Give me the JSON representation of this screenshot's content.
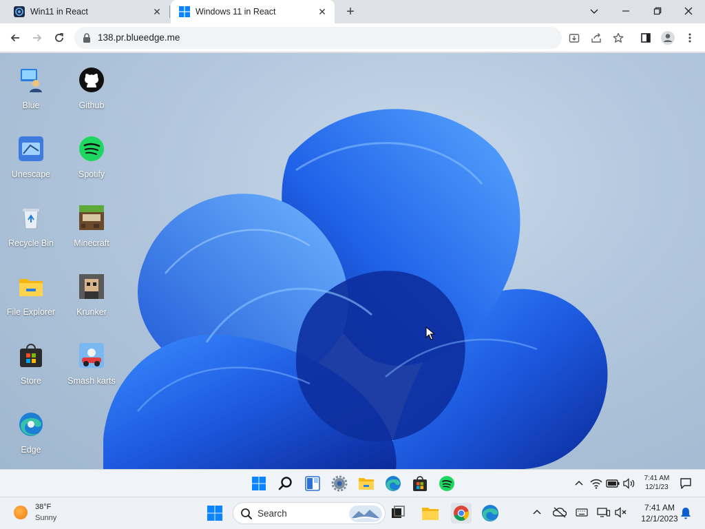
{
  "browser": {
    "tabs": [
      {
        "title": "Win11 in React",
        "active": false
      },
      {
        "title": "Windows 11 in React",
        "active": true
      }
    ],
    "address": "138.pr.blueedge.me"
  },
  "desktop": {
    "icons": [
      {
        "label": "Blue",
        "icon": "blue-user-icon"
      },
      {
        "label": "Github",
        "icon": "github-icon"
      },
      {
        "label": "Unescape",
        "icon": "unescape-icon"
      },
      {
        "label": "Spotify",
        "icon": "spotify-icon"
      },
      {
        "label": "Recycle Bin",
        "icon": "recycle-bin-icon"
      },
      {
        "label": "Minecraft",
        "icon": "minecraft-icon"
      },
      {
        "label": "File Explorer",
        "icon": "folder-icon"
      },
      {
        "label": "Krunker",
        "icon": "krunker-icon"
      },
      {
        "label": "Store",
        "icon": "store-icon"
      },
      {
        "label": "Smash karts",
        "icon": "smash-karts-icon"
      },
      {
        "label": "Edge",
        "icon": "edge-icon"
      }
    ]
  },
  "inner_taskbar": {
    "time": "7:41 AM",
    "date": "12/1/23"
  },
  "host_taskbar": {
    "weather_temp": "38°F",
    "weather_condition": "Sunny",
    "search_placeholder": "Search",
    "time": "7:41 AM",
    "date": "12/1/2023"
  },
  "colors": {
    "accent_blue": "#1a73e8",
    "bloom_blue": "#1d5ae0",
    "spotify_green": "#1ed760"
  }
}
